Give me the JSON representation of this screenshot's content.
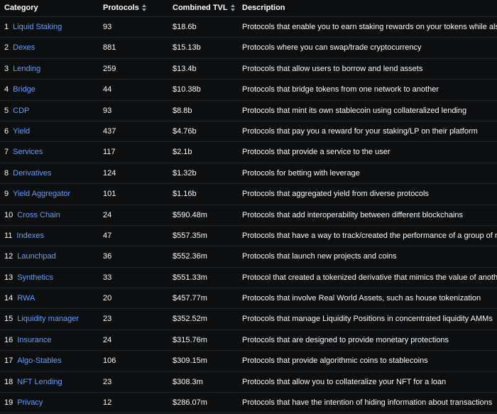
{
  "header": {
    "category": "Category",
    "protocols": "Protocols",
    "tvl": "Combined TVL",
    "description": "Description"
  },
  "rows": [
    {
      "n": "1",
      "category": "Liquid Staking",
      "protocols": "93",
      "tvl": "$18.6b",
      "description": "Protocols that enable you to earn staking rewards on your tokens while also p"
    },
    {
      "n": "2",
      "category": "Dexes",
      "protocols": "881",
      "tvl": "$15.13b",
      "description": "Protocols where you can swap/trade cryptocurrency"
    },
    {
      "n": "3",
      "category": "Lending",
      "protocols": "259",
      "tvl": "$13.4b",
      "description": "Protocols that allow users to borrow and lend assets"
    },
    {
      "n": "4",
      "category": "Bridge",
      "protocols": "44",
      "tvl": "$10.38b",
      "description": "Protocols that bridge tokens from one network to another"
    },
    {
      "n": "5",
      "category": "CDP",
      "protocols": "93",
      "tvl": "$8.8b",
      "description": "Protocols that mint its own stablecoin using collateralized lending"
    },
    {
      "n": "6",
      "category": "Yield",
      "protocols": "437",
      "tvl": "$4.76b",
      "description": "Protocols that pay you a reward for your staking/LP on their platform"
    },
    {
      "n": "7",
      "category": "Services",
      "protocols": "117",
      "tvl": "$2.1b",
      "description": "Protocols that provide a service to the user"
    },
    {
      "n": "8",
      "category": "Derivatives",
      "protocols": "124",
      "tvl": "$1.32b",
      "description": "Protocols for betting with leverage"
    },
    {
      "n": "9",
      "category": "Yield Aggregator",
      "protocols": "101",
      "tvl": "$1.16b",
      "description": "Protocols that aggregated yield from diverse protocols"
    },
    {
      "n": "10",
      "category": "Cross Chain",
      "protocols": "24",
      "tvl": "$590.48m",
      "description": "Protocols that add interoperability between different blockchains"
    },
    {
      "n": "11",
      "category": "Indexes",
      "protocols": "47",
      "tvl": "$557.35m",
      "description": "Protocols that have a way to track/created the performance of a group of rel"
    },
    {
      "n": "12",
      "category": "Launchpad",
      "protocols": "36",
      "tvl": "$552.36m",
      "description": "Protocols that launch new projects and coins"
    },
    {
      "n": "13",
      "category": "Synthetics",
      "protocols": "33",
      "tvl": "$551.33m",
      "description": "Protocol that created a tokenized derivative that mimics the value of another"
    },
    {
      "n": "14",
      "category": "RWA",
      "protocols": "20",
      "tvl": "$457.77m",
      "description": "Protocols that involve Real World Assets, such as house tokenization"
    },
    {
      "n": "15",
      "category": "Liquidity manager",
      "protocols": "23",
      "tvl": "$352.52m",
      "description": "Protocols that manage Liquidity Positions in concentrated liquidity AMMs"
    },
    {
      "n": "16",
      "category": "Insurance",
      "protocols": "24",
      "tvl": "$315.76m",
      "description": "Protocols that are designed to provide monetary protections"
    },
    {
      "n": "17",
      "category": "Algo-Stables",
      "protocols": "106",
      "tvl": "$309.15m",
      "description": "Protocols that provide algorithmic coins to stablecoins"
    },
    {
      "n": "18",
      "category": "NFT Lending",
      "protocols": "23",
      "tvl": "$308.3m",
      "description": "Protocols that allow you to collateralize your NFT for a loan"
    },
    {
      "n": "19",
      "category": "Privacy",
      "protocols": "12",
      "tvl": "$286.07m",
      "description": "Protocols that have the intention of hiding information about transactions"
    }
  ]
}
